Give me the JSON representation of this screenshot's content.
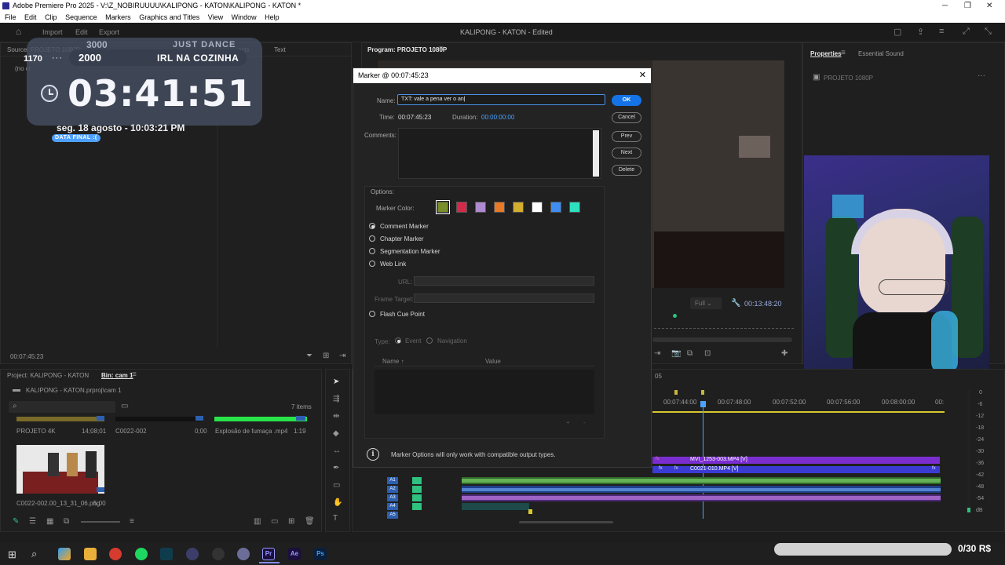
{
  "window": {
    "title": "Adobe Premiere Pro 2025 - V:\\Z_NOBIRUUUU\\KALIPONG - KATON\\KALIPONG - KATON *",
    "menu": [
      "File",
      "Edit",
      "Clip",
      "Sequence",
      "Markers",
      "Graphics and Titles",
      "View",
      "Window",
      "Help"
    ]
  },
  "header": {
    "nav": [
      "Import",
      "Edit",
      "Export"
    ],
    "project_title": "KALIPONG - KATON - Edited"
  },
  "overlay": {
    "counter_left": "1170",
    "counter_top": "3000",
    "counter_value": "2000",
    "top_label": "JUST DANCE",
    "pill_label": "IRL NA COZINHA",
    "time": "03:41:51",
    "date": "seg. 18 agosto - 10:03:21 PM",
    "badge": "DATA FINAL :("
  },
  "source_panel": {
    "title": "Source: PROJETO 1080P:",
    "tab_text": "Text",
    "tab_partial": "ects",
    "no_clip": "(no cl",
    "timecode": "00:07:45:23"
  },
  "program_panel": {
    "title": "Program: PROJETO 1080P",
    "fit": "Full",
    "timecode": "00:13:48:20"
  },
  "right_panel": {
    "tabs": [
      "Properties",
      "Essential Sound"
    ],
    "sequence": "PROJETO 1080P"
  },
  "project_panel": {
    "tab_project": "Project: KALIPONG - KATON",
    "tab_bin": "Bin: cam 1",
    "file": "KALIPONG - KATON.prproj\\cam 1",
    "count": "7 items",
    "items": [
      {
        "name": "PROJETO 4K",
        "duration": "14;08;01"
      },
      {
        "name": "C0022-002",
        "duration": "0;00"
      },
      {
        "name": "Explosão de fumaça .mp4",
        "duration": "1:19"
      },
      {
        "name": "C0022-002.00_13_31_06.png",
        "duration": "5:00"
      }
    ]
  },
  "marker_dialog": {
    "title": "Marker @ 00:07:45:23",
    "name_label": "Name:",
    "name_value": "TXT: vale a pena ver o an",
    "time_label": "Time:",
    "time_value": "00:07:45:23",
    "duration_label": "Duration:",
    "duration_value": "00:00:00:00",
    "comments_label": "Comments:",
    "buttons": {
      "ok": "OK",
      "cancel": "Cancel",
      "prev": "Prev",
      "next": "Next",
      "delete": "Delete"
    },
    "options_label": "Options:",
    "color_label": "Marker Color:",
    "colors": [
      "#7a8f2a",
      "#d42a4a",
      "#b08ad0",
      "#e77a26",
      "#d4ae2e",
      "#ffffff",
      "#3d8ef0",
      "#2ee0c0"
    ],
    "marker_types": [
      "Comment Marker",
      "Chapter Marker",
      "Segmentation Marker",
      "Web Link"
    ],
    "url_label": "URL:",
    "frame_label": "Frame Target:",
    "flash": "Flash Cue Point",
    "type_label": "Type:",
    "type_event": "Event",
    "type_nav": "Navigation",
    "col_name": "Name ↑",
    "col_value": "Value",
    "info": "Marker Options will only work with compatible output types."
  },
  "timeline": {
    "ruler": [
      "00:07:44:00",
      "00:07:48:00",
      "00:07:52:00",
      "00:07:56:00",
      "00:08:00:00",
      "00:"
    ],
    "ruler_left": "05",
    "video_clips": [
      "MVI_1253-003.MP4 [V]",
      "C0021-010.MP4 [V]"
    ],
    "audio_tracks": [
      "A1",
      "A2",
      "A3",
      "A4",
      "A5"
    ],
    "meter": [
      "0",
      "-6",
      "-12",
      "-18",
      "-24",
      "-30",
      "-36",
      "-42",
      "-48",
      "-54",
      "dB"
    ]
  },
  "taskbar": {
    "price": "0/30 R$"
  }
}
